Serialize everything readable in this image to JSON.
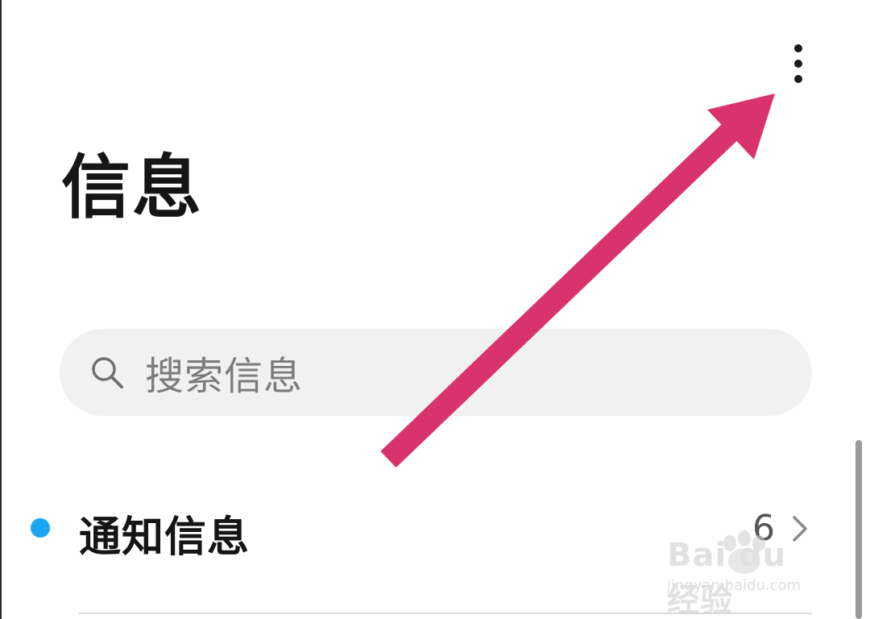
{
  "header": {
    "title": "信息",
    "more_icon": "more-vertical-icon"
  },
  "search": {
    "placeholder": "搜索信息",
    "icon": "search-icon"
  },
  "conversations": [
    {
      "label": "通知信息",
      "count": "6",
      "unread": true,
      "trailing_icon": "chevron-right-icon"
    }
  ],
  "annotation": {
    "arrow_color": "#d9336e"
  },
  "watermark": {
    "brand": "Bai du 经验",
    "url": "jingyan.baidu.com"
  },
  "colors": {
    "unread_dot": "#1aa6f0",
    "search_bg": "#f1f1f1",
    "title_text": "#151515"
  }
}
